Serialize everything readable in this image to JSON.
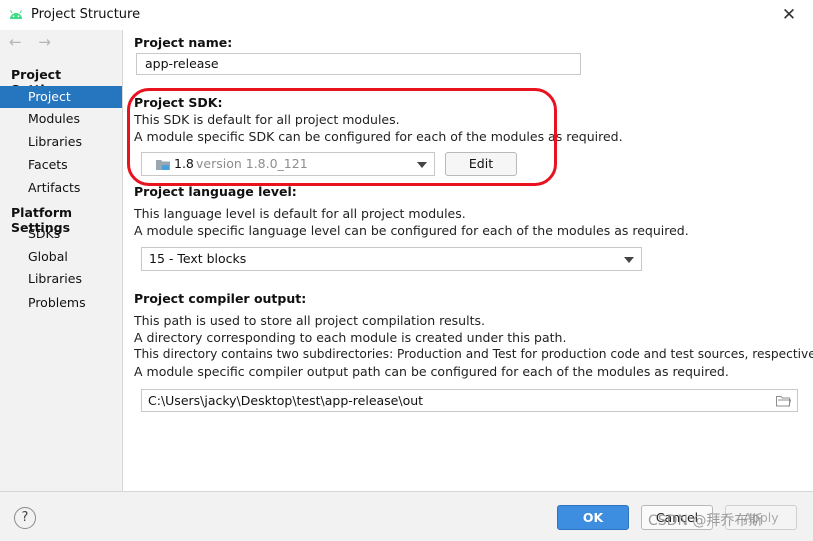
{
  "window": {
    "title": "Project Structure",
    "close_symbol": "✕"
  },
  "sidebar": {
    "nav_arrows": "← →",
    "project_settings_header": "Project Settings",
    "items": [
      {
        "label": "Project",
        "selected": true
      },
      {
        "label": "Modules"
      },
      {
        "label": "Libraries"
      },
      {
        "label": "Facets"
      },
      {
        "label": "Artifacts"
      }
    ],
    "platform_settings_header": "Platform Settings",
    "platform_items": [
      {
        "label": "SDKs"
      },
      {
        "label": "Global Libraries"
      }
    ],
    "problems": "Problems"
  },
  "project_name": {
    "label": "Project name:",
    "value": "app-release"
  },
  "project_sdk": {
    "label": "Project SDK:",
    "desc1": "This SDK is default for all project modules.",
    "desc2": "A module specific SDK can be configured for each of the modules as required.",
    "selected_name": "1.8",
    "selected_version": "version 1.8.0_121",
    "edit_button": "Edit"
  },
  "language_level": {
    "label": "Project language level:",
    "desc1": "This language level is default for all project modules.",
    "desc2": "A module specific language level can be configured for each of the modules as required.",
    "value": "15 - Text blocks"
  },
  "compiler_output": {
    "label": "Project compiler output:",
    "desc1": "This path is used to store all project compilation results.",
    "desc2": "A directory corresponding to each module is created under this path.",
    "desc3": "This directory contains two subdirectories: Production and Test for production code and test sources, respectively.",
    "desc4": "A module specific compiler output path can be configured for each of the modules as required.",
    "path": "C:\\Users\\jacky\\Desktop\\test\\app-release\\out"
  },
  "footer": {
    "help": "?",
    "ok": "OK",
    "cancel": "Cancel",
    "apply": "Apply",
    "watermark": "CSDN @拜乔布斯"
  },
  "colors": {
    "selection": "#2675bf",
    "ok_button": "#3d8de0",
    "annotation_red": "#e8131f",
    "android_green": "#3ddc84"
  }
}
